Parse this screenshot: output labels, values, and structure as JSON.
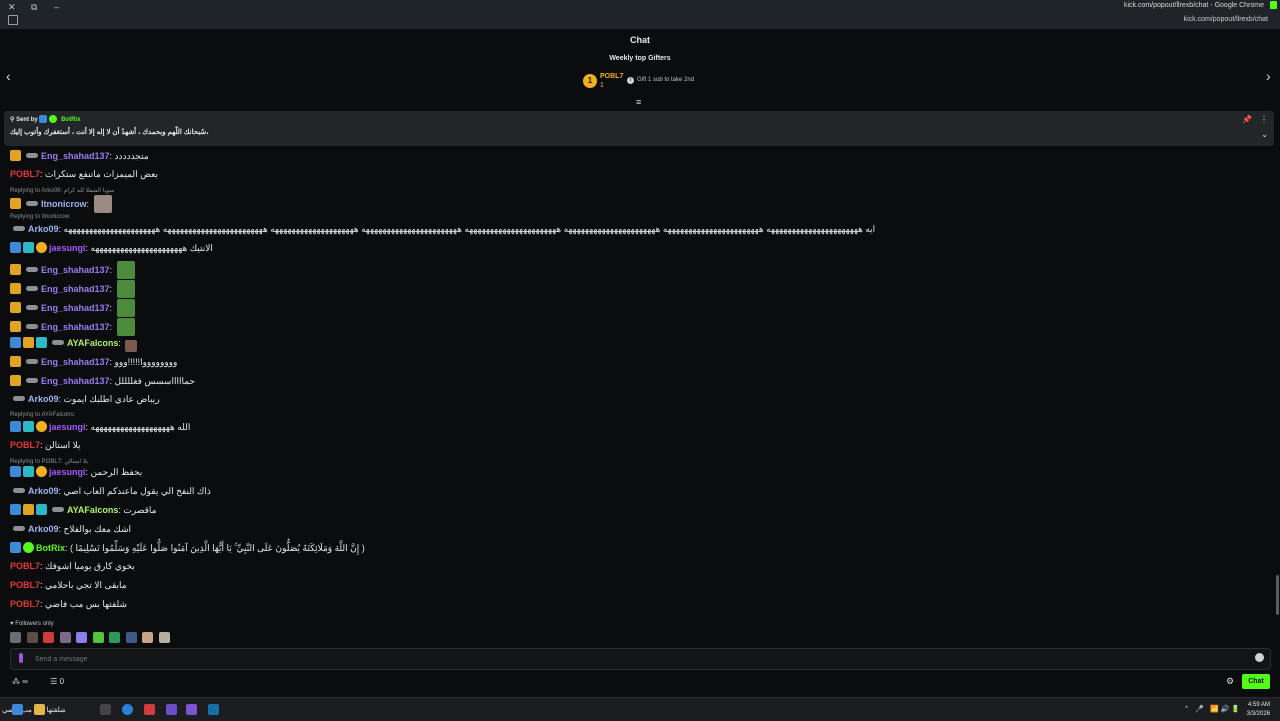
{
  "browser": {
    "window_title": "kick.com/popout/llrexb/chat - Google Chrome",
    "url": "kick.com/popout/llrexb/chat"
  },
  "chat": {
    "header_title": "Chat",
    "gifters": {
      "title": "Weekly top Gifters",
      "rank_badge": "1",
      "top_name": "POBL7",
      "top_count": "1",
      "gift_hint": "Gift 1 sub to take 2nd"
    },
    "pinned": {
      "sent_by_label": "Sent by",
      "sent_by_name": "BotRix",
      "text": "،سُبحانك اللّهم وبحمدك ، أشهدُ أن لا إله إلا أنت ، أستغفرك وأتوب إليك"
    },
    "messages": [
      {
        "user": "Eng_shahad137",
        "color": "#9b7bf0",
        "text": "متجددددد"
      },
      {
        "user": "POBL7",
        "color": "#e53935",
        "text": "بعض الميمزات ماتنفع ستكرات"
      },
      {
        "reply": "Replying to Arko09: سويا الشفلا لله كرام"
      },
      {
        "user": "Itnonicrow",
        "color": "#9bb4f0",
        "text": ""
      },
      {
        "reply": "Replying to Itnonicrow:"
      },
      {
        "user": "Arko09",
        "color": "#9bb4f0",
        "text": "ايه ههههههههههههههههههههههه هههههههههههههههههههههههه ههههههههههههههههههههههه ههههههههههههههههههههههه هههههههههههههههههههههههه ههههههههههههههههههههه ههههههههههههههههههههههههه ههههههههههههههههههههههه"
      },
      {
        "user": "jaesungi",
        "color": "#a259ff",
        "text": "الانتيك ههههههههههههههههههههههه"
      },
      {
        "user": "Eng_shahad137",
        "color": "#9b7bf0",
        "text": ""
      },
      {
        "user": "Eng_shahad137",
        "color": "#9b7bf0",
        "text": ""
      },
      {
        "user": "Eng_shahad137",
        "color": "#9b7bf0",
        "text": ""
      },
      {
        "user": "Eng_shahad137",
        "color": "#9b7bf0",
        "text": ""
      },
      {
        "user": "AYAFalcons",
        "color": "#b0f26a",
        "text": ""
      },
      {
        "user": "Eng_shahad137",
        "color": "#9b7bf0",
        "text": "ووووووووا!!!!!ووو"
      },
      {
        "user": "Eng_shahad137",
        "color": "#9b7bf0",
        "text": "حماااااسسس فغللللل"
      },
      {
        "user": "Arko09",
        "color": "#9bb4f0",
        "text": "ريباض عادي اطلبك ايموت"
      },
      {
        "reply": "Replying to AYAFalcons:"
      },
      {
        "user": "jaesungi",
        "color": "#a259ff",
        "text": "الله هههههههههههههههههههه"
      },
      {
        "user": "POBL7",
        "color": "#e53935",
        "text": "يلا استالن"
      },
      {
        "reply": "Replying to POBL7: يلا استالن"
      },
      {
        "user": "jaesungi",
        "color": "#a259ff",
        "text": "بحفظ الرحمن"
      },
      {
        "user": "Arko09",
        "color": "#9bb4f0",
        "text": "ذاك النفخ الي يقول ماعندكم العاب اصي"
      },
      {
        "user": "AYAFalcons",
        "color": "#b0f26a",
        "text": "ماقصرت"
      },
      {
        "user": "Arko09",
        "color": "#9bb4f0",
        "text": "اشك معك بوالفلاح"
      },
      {
        "user": "BotRix",
        "color": "#53fc18",
        "text": "( إِنَّ اللَّهَ وَمَلَائِكَتَهُ يُصَلُّونَ عَلَى النَّبِيِّ ۚ يَا أَيُّهَا الَّذِينَ آمَنُوا صَلُّوا عَلَيْهِ وَسَلِّمُوا تَسْلِيمًا )"
      },
      {
        "user": "POBL7",
        "color": "#e53935",
        "text": "بخوي كارق يوميا اشوفك"
      },
      {
        "user": "POBL7",
        "color": "#e53935",
        "text": "مابقى الا تجي باحلامي"
      },
      {
        "user": "POBL7",
        "color": "#e53935",
        "text": "شلفتها بس مب فاضي"
      }
    ],
    "followers_only_label": "Followers only",
    "input_placeholder": "Send a message",
    "bottom": {
      "points_label": "∞",
      "viewers_count": "0",
      "chat_button": "Chat"
    }
  },
  "taskbar": {
    "ticker_text": "شلفتها بس مب فاضي",
    "time": "4:59 AM",
    "date": "3/3/2026"
  }
}
